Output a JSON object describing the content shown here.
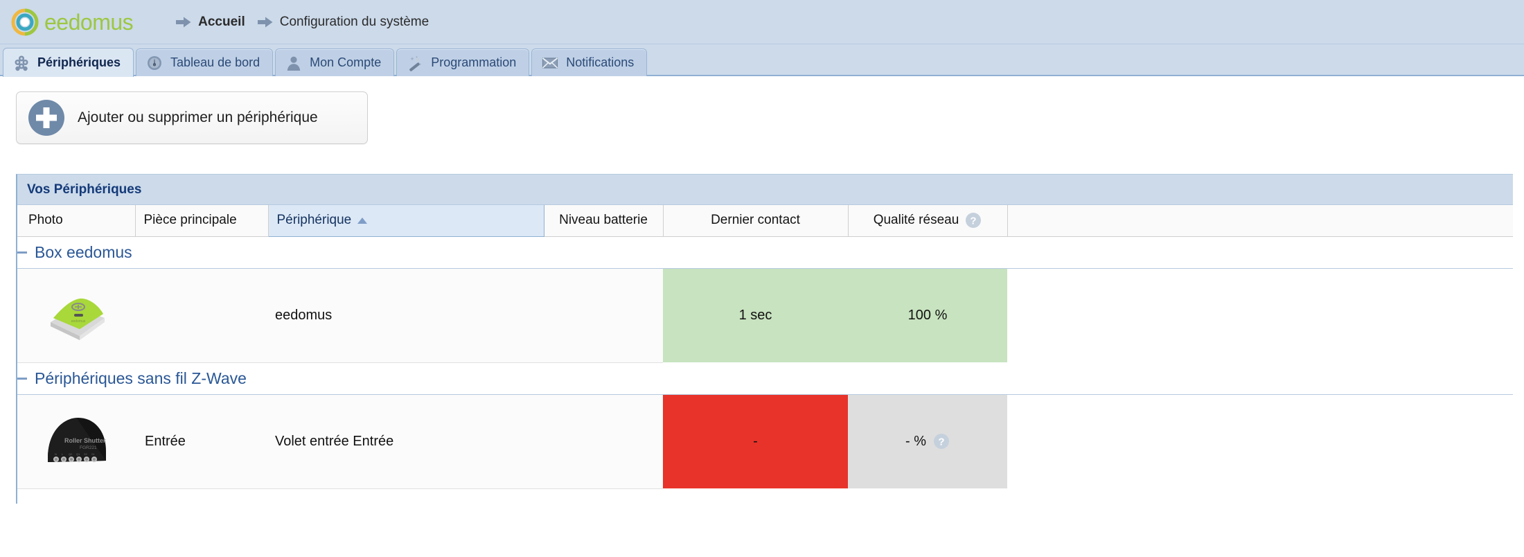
{
  "brand": {
    "name": "eedomus",
    "logo_icon": "eedomus-ring-logo",
    "logo_colors": {
      "green": "#9dc741",
      "yellow": "#f0b840",
      "blue": "#3aa8c1"
    }
  },
  "breadcrumb": {
    "arrow_icon": "arrow-right-icon",
    "items": [
      {
        "label": "Accueil",
        "bold": true
      },
      {
        "label": "Configuration du système",
        "bold": false
      }
    ]
  },
  "tabs": [
    {
      "label": "Périphériques",
      "icon": "devices-cluster-icon",
      "active": true
    },
    {
      "label": "Tableau de bord",
      "icon": "gauge-icon",
      "active": false
    },
    {
      "label": "Mon Compte",
      "icon": "user-icon",
      "active": false
    },
    {
      "label": "Programmation",
      "icon": "magic-wand-icon",
      "active": false
    },
    {
      "label": "Notifications",
      "icon": "envelope-icon",
      "active": false
    }
  ],
  "toolbar": {
    "add_device_label": "Ajouter ou supprimer un périphérique",
    "add_device_icon": "plus-circle-icon"
  },
  "panel": {
    "title": "Vos Périphériques",
    "columns": [
      {
        "label": "Photo",
        "sorted": false,
        "help": false
      },
      {
        "label": "Pièce principale",
        "sorted": false,
        "help": false
      },
      {
        "label": "Périphérique",
        "sorted": true,
        "sort_dir": "asc",
        "help": false
      },
      {
        "label": "Niveau batterie",
        "sorted": false,
        "help": false
      },
      {
        "label": "Dernier contact",
        "sorted": false,
        "help": false
      },
      {
        "label": "Qualité réseau",
        "sorted": false,
        "help": true,
        "help_icon": "question-mark-icon"
      },
      {
        "label": "",
        "sorted": false,
        "help": false
      }
    ],
    "groups": [
      {
        "label": "Box eedomus",
        "collapse_icon": "minus-icon",
        "rows": [
          {
            "photo_icon": "eedomus-box-photo",
            "room": "",
            "device": "eedomus",
            "battery": "",
            "battery_state": "plain",
            "last_contact": "1 sec",
            "last_contact_state": "green",
            "network_quality": "100 %",
            "network_quality_state": "green",
            "network_help": false
          }
        ]
      },
      {
        "label": "Périphériques sans fil Z-Wave",
        "collapse_icon": "minus-icon",
        "rows": [
          {
            "photo_icon": "roller-shutter-module-photo",
            "photo_text": "Roller Shutter",
            "photo_subtext": "FGR221",
            "room": "Entrée",
            "device": "Volet entrée Entrée",
            "battery": "",
            "battery_state": "plain",
            "last_contact": "-",
            "last_contact_state": "red",
            "network_quality": "- %",
            "network_quality_state": "gray",
            "network_help": true,
            "network_help_icon": "question-mark-icon"
          }
        ]
      }
    ]
  },
  "colors": {
    "chrome_blue": "#ccdaea",
    "tab_active": "#dbe6f3",
    "status_ok": "#c7e3bf",
    "status_error": "#e8332a",
    "status_unknown": "#dedede",
    "link_blue": "#2a5796"
  }
}
